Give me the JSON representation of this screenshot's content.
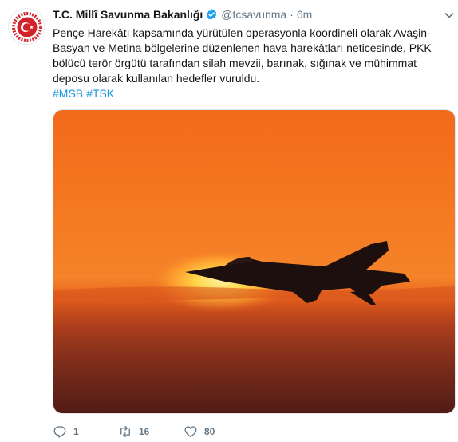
{
  "tweet": {
    "author_name": "T.C. Millî Savunma Bakanlığı",
    "handle": "@tcsavunma",
    "separator": "·",
    "time": "6m",
    "text": "Pençe Harekâtı kapsamında yürütülen operasyonla koordineli olarak Avaşin-Basyan ve Metina bölgelerine düzenlenen hava harekâtları neticesinde, PKK bölücü terör örgütü tarafından silah mevzii, barınak, sığınak ve mühimmat deposu olarak kullanılan hedefler vuruldu.",
    "hashtags": [
      "#MSB",
      "#TSK"
    ],
    "media": {
      "description_icon": "sunset-fighter-jet-photo"
    },
    "actions": {
      "reply_count": "1",
      "retweet_count": "16",
      "like_count": "80"
    }
  },
  "icons": {
    "verified": "verified-badge-icon",
    "caret": "chevron-down-icon",
    "reply": "reply-icon",
    "retweet": "retweet-icon",
    "like": "heart-icon"
  },
  "colors": {
    "name": "#14171a",
    "secondary": "#657786",
    "link": "#1b95e0",
    "verified": "#1da1f2",
    "logo_red": "#d2232a"
  }
}
